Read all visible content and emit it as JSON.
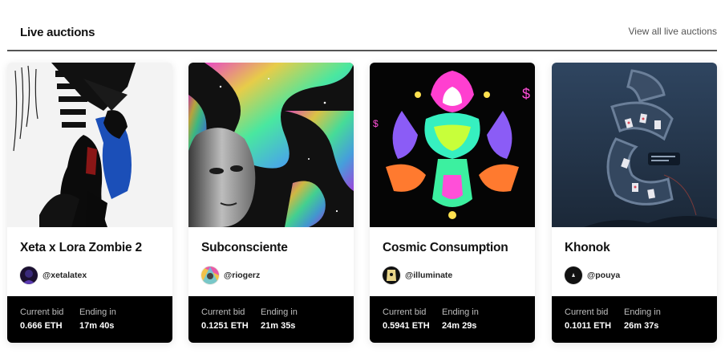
{
  "section": {
    "title": "Live auctions",
    "view_all_label": "View all live auctions"
  },
  "labels": {
    "current_bid": "Current bid",
    "ending_in": "Ending in"
  },
  "auctions": [
    {
      "title": "Xeta x Lora Zombie 2",
      "creator": "@xetalatex",
      "current_bid": "0.666 ETH",
      "ending_in": "17m  40s"
    },
    {
      "title": "Subconsciente",
      "creator": "@riogerz",
      "current_bid": "0.1251 ETH",
      "ending_in": "21m  35s"
    },
    {
      "title": "Cosmic Consumption",
      "creator": "@illuminate",
      "current_bid": "0.5941 ETH",
      "ending_in": "24m  29s"
    },
    {
      "title": "Khonok",
      "creator": "@pouya",
      "current_bid": "0.1011 ETH",
      "ending_in": "26m  37s"
    }
  ]
}
